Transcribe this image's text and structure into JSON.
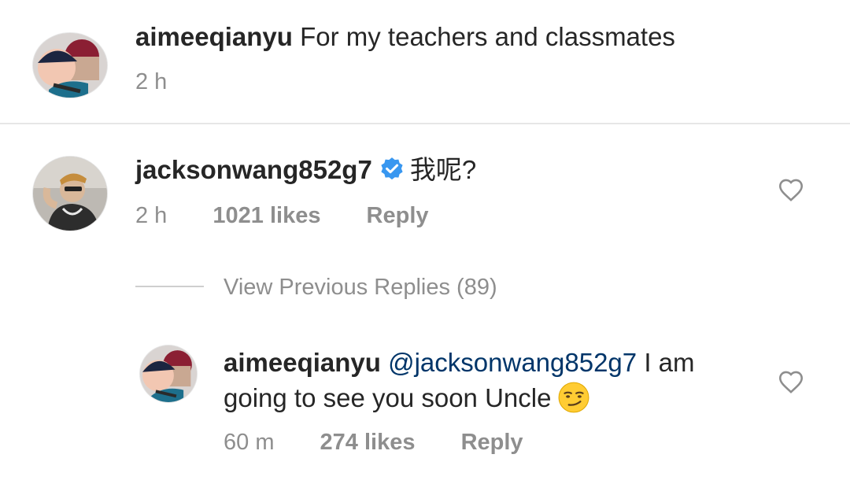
{
  "comments": [
    {
      "username": "aimeeqianyu",
      "text": "For my teachers and classmates",
      "time": "2 h"
    },
    {
      "username": "jacksonwang852g7",
      "verified": true,
      "text": "我呢?",
      "time": "2 h",
      "likes": "1021 likes",
      "reply_label": "Reply",
      "view_replies": "View Previous Replies (89)",
      "replies": [
        {
          "username": "aimeeqianyu",
          "mention": "@jacksonwang852g7",
          "text_line1": "I am",
          "text_line2": "going to see you soon Uncle",
          "emoji": "smirking-face",
          "time": "60 m",
          "likes": "274 likes",
          "reply_label": "Reply"
        }
      ]
    }
  ],
  "icons": {
    "like": "heart-outline-icon",
    "verified": "verified-badge-icon"
  },
  "colors": {
    "verified": "#3897f0",
    "mention": "#003569",
    "meta": "#8e8e8e"
  }
}
